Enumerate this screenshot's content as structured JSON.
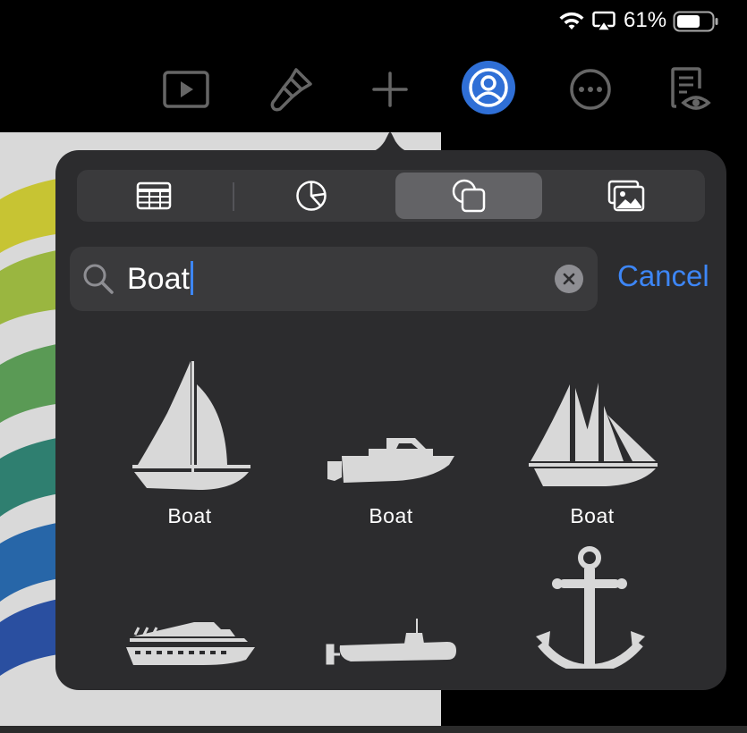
{
  "status_bar": {
    "battery_percent": "61%",
    "icons": [
      "wifi-icon",
      "airplay-icon",
      "battery-icon"
    ],
    "battery_level": 0.61
  },
  "toolbar": {
    "items": [
      "play-icon",
      "format-brush-icon",
      "add-icon",
      "collaborate-icon",
      "more-icon",
      "reader-view-icon"
    ],
    "accent_color": "#2f6fd6"
  },
  "insert_popover": {
    "tabs": [
      "table-icon",
      "chart-icon",
      "shapes-icon",
      "media-icon"
    ],
    "selected_tab": "shapes-icon",
    "search": {
      "query": "Boat",
      "cancel_label": "Cancel"
    },
    "results": [
      {
        "label": "Boat",
        "icon": "sailboat-icon"
      },
      {
        "label": "Boat",
        "icon": "motorboat-icon"
      },
      {
        "label": "Boat",
        "icon": "schooner-icon"
      },
      {
        "label": "",
        "icon": "cruise-ship-icon"
      },
      {
        "label": "",
        "icon": "submarine-icon"
      },
      {
        "label": "",
        "icon": "anchor-icon"
      }
    ]
  },
  "colors": {
    "popover_bg": "#2c2c2e",
    "link_blue": "#3d86f6",
    "shape_fill": "#d8d8d8"
  }
}
